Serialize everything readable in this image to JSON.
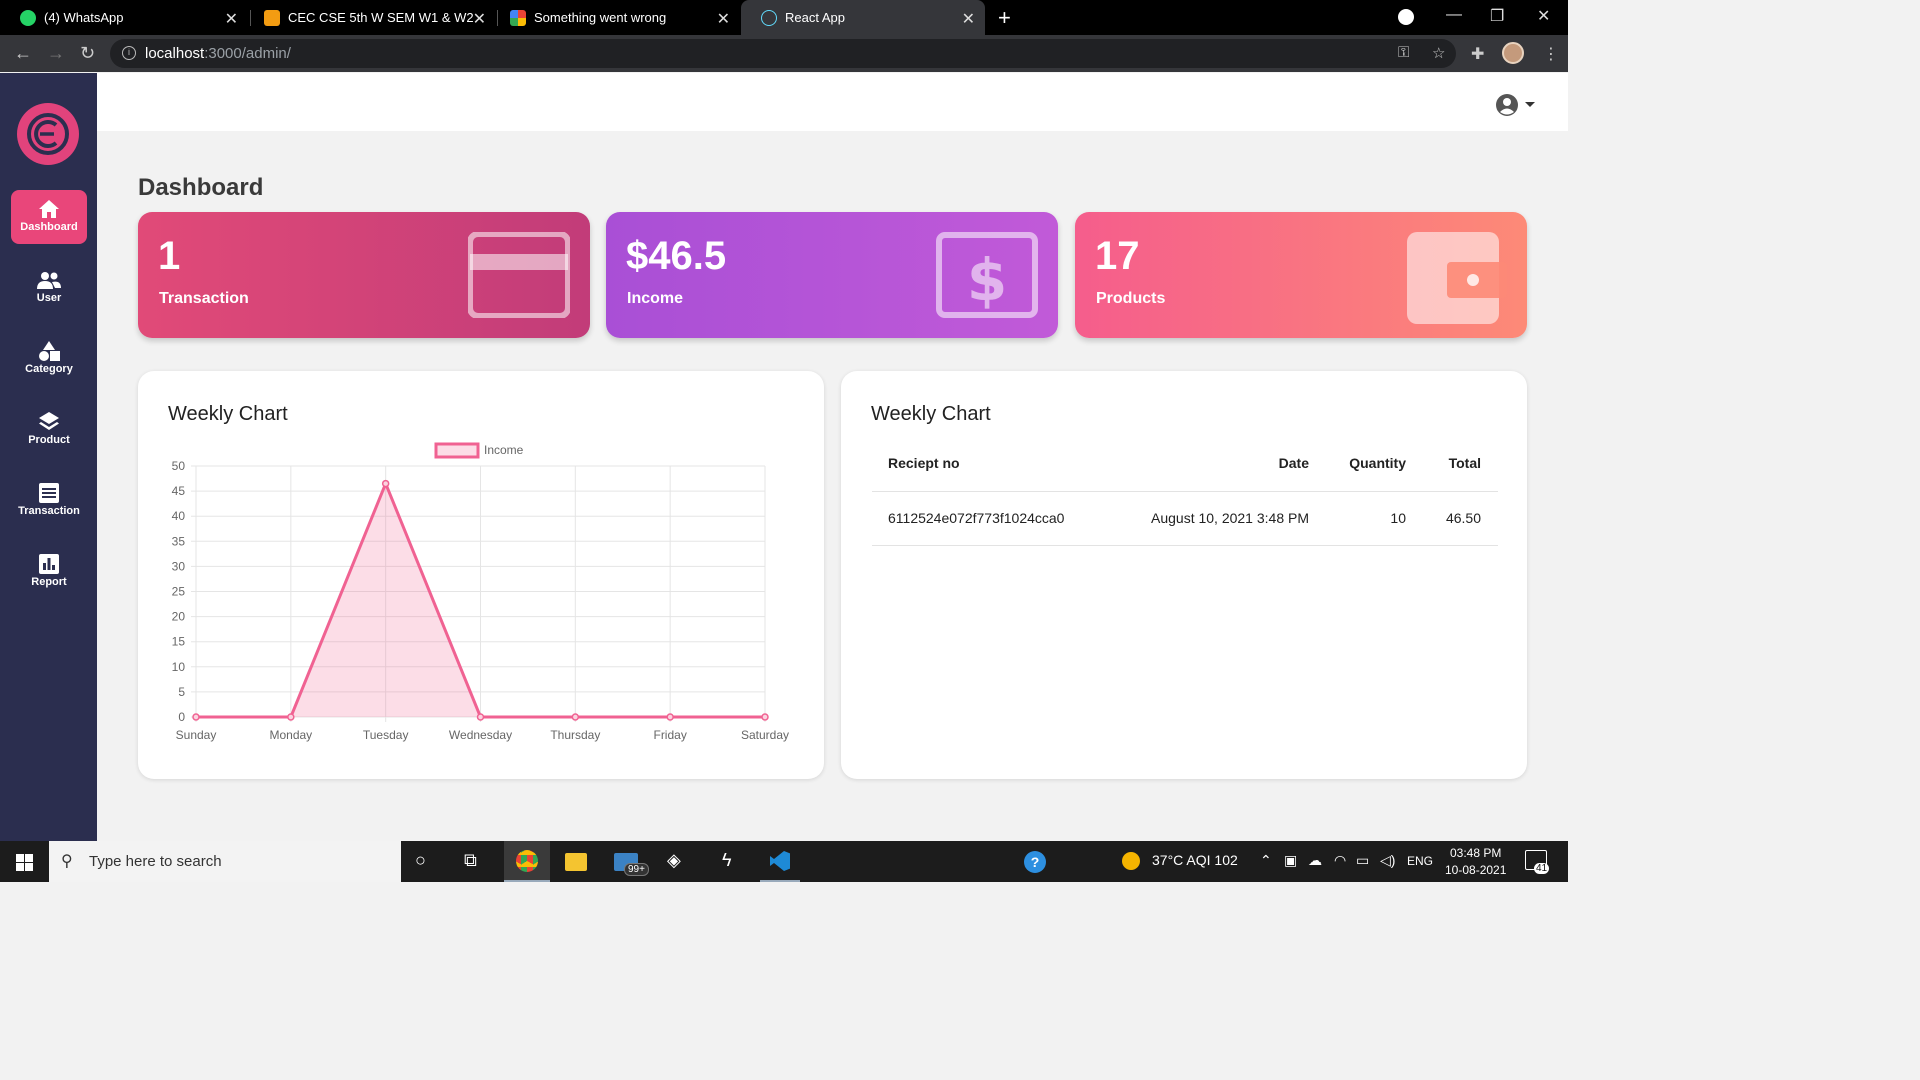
{
  "browser": {
    "tabs": [
      {
        "title": "(4) WhatsApp",
        "favicon_color": "#25d366"
      },
      {
        "title": "CEC CSE 5th W SEM W1 & W2",
        "favicon_color": "#f39c12"
      },
      {
        "title": "Something went wrong",
        "favicon_color": "#34a853"
      },
      {
        "title": "React App",
        "favicon_color": "#61dafb"
      }
    ],
    "url_host": "localhost",
    "url_rest": ":3000/admin/"
  },
  "sidebar": {
    "items": [
      {
        "label": "Dashboard",
        "icon": "home-icon",
        "active": true
      },
      {
        "label": "User",
        "icon": "users-icon"
      },
      {
        "label": "Category",
        "icon": "shapes-icon"
      },
      {
        "label": "Product",
        "icon": "layers-icon"
      },
      {
        "label": "Transaction",
        "icon": "list-icon"
      },
      {
        "label": "Report",
        "icon": "bar-chart-icon"
      }
    ]
  },
  "page": {
    "title": "Dashboard"
  },
  "cards": [
    {
      "value": "1",
      "label": "Transaction",
      "icon": "credit-card-icon",
      "gradient": [
        "#e14a78",
        "#c23c79"
      ]
    },
    {
      "value": "$46.5",
      "label": "Income",
      "icon": "dollar-icon",
      "gradient": [
        "#a94fd6",
        "#c15ad8"
      ]
    },
    {
      "value": "17",
      "label": "Products",
      "icon": "wallet-icon",
      "gradient": [
        "#f55d8c",
        "#fd8a77"
      ]
    }
  ],
  "chart_panel": {
    "title": "Weekly Chart"
  },
  "chart_data": {
    "type": "area",
    "title": "",
    "categories": [
      "Sunday",
      "Monday",
      "Tuesday",
      "Wednesday",
      "Thursday",
      "Friday",
      "Saturday"
    ],
    "series": [
      {
        "name": "Income",
        "values": [
          0,
          0,
          46.5,
          0,
          0,
          0,
          0
        ],
        "color": "#f06292"
      }
    ],
    "ylim": [
      0,
      50
    ],
    "yticks": [
      "0",
      "5",
      "10",
      "15",
      "20",
      "25",
      "30",
      "35",
      "40",
      "45",
      "50"
    ],
    "grid": true,
    "legend": "top"
  },
  "table_panel": {
    "title": "Weekly Chart",
    "headers": {
      "receipt": "Reciept no",
      "date": "Date",
      "quantity": "Quantity",
      "total": "Total"
    },
    "rows": [
      {
        "receipt": "6112524e072f773f1024cca0",
        "date": "August 10, 2021 3:48 PM",
        "quantity": "10",
        "total": "46.50"
      }
    ]
  },
  "taskbar": {
    "search_placeholder": "Type here to search",
    "mail_badge": "99+",
    "weather": "37°C  AQI 102",
    "lang": "ENG",
    "time": "03:48 PM",
    "date": "10-08-2021",
    "notif_count": "41"
  }
}
